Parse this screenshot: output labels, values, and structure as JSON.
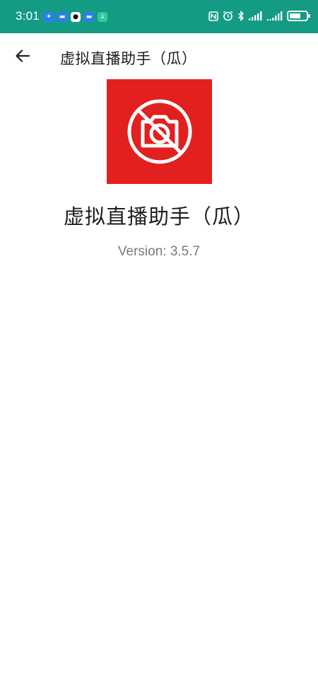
{
  "status_bar": {
    "time": "3:01",
    "notification_icons": [
      "app-notification-icon",
      "message-icon",
      "qq-icon",
      "message-icon",
      "download-icon"
    ],
    "system_icons": [
      "nfc-icon",
      "alarm-icon",
      "bluetooth-icon",
      "signal-icon",
      "signal-icon",
      "battery-icon"
    ],
    "background_color": "#139b84"
  },
  "app_bar": {
    "title": "虚拟直播助手（瓜）",
    "back_icon": "arrow-left-icon"
  },
  "about": {
    "logo_icon": "no-camera-icon",
    "logo_color": "#e2201f",
    "app_name": "虚拟直播助手（瓜）",
    "version": "Version: 3.5.7"
  }
}
